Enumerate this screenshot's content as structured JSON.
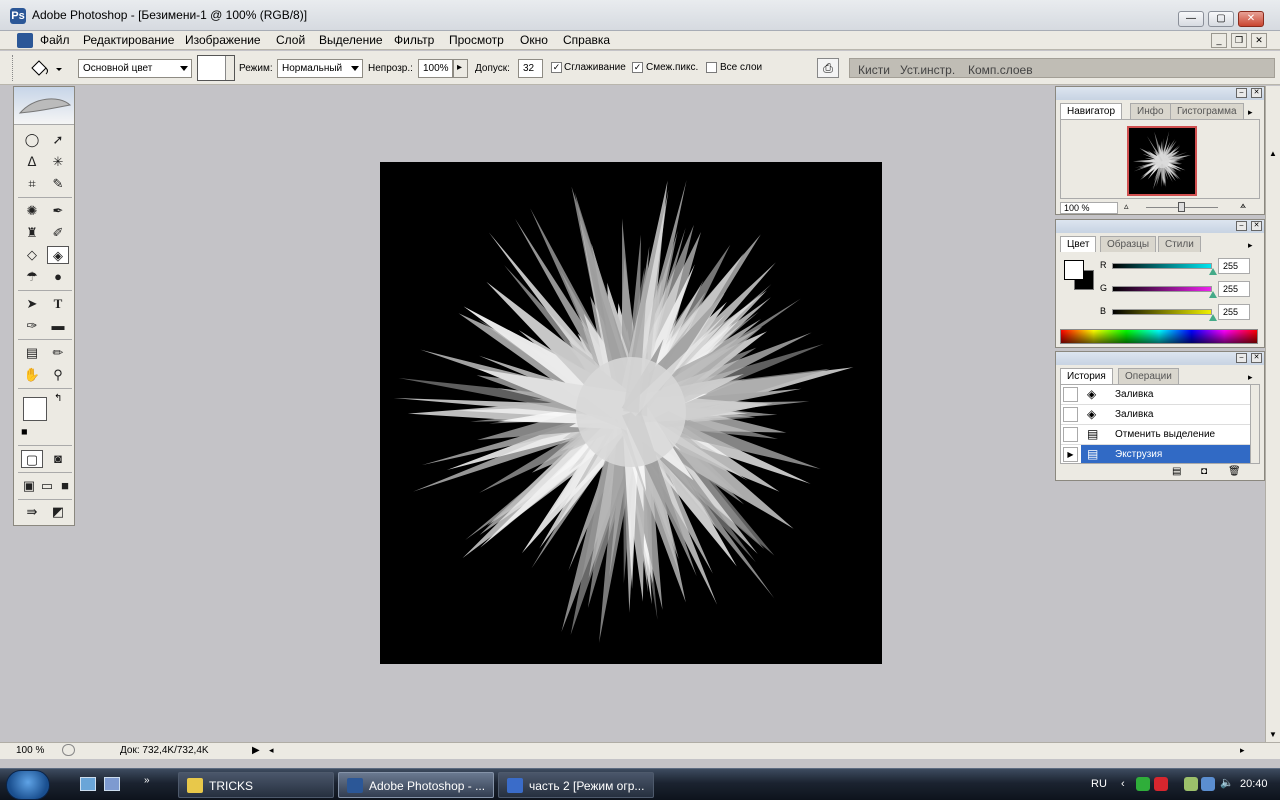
{
  "window": {
    "title": "Adobe Photoshop - [Безимени-1 @ 100% (RGB/8)]",
    "icon": "photoshop-feather-icon"
  },
  "menu": {
    "items": [
      "Файл",
      "Редактирование",
      "Изображение",
      "Слой",
      "Выделение",
      "Фильтр",
      "Просмотр",
      "Окно",
      "Справка"
    ]
  },
  "options": {
    "fill_source": "Основной цвет",
    "mode_label": "Режим:",
    "mode_value": "Нормальный",
    "opacity_label": "Непрозр.:",
    "opacity_value": "100%",
    "tolerance_label": "Допуск:",
    "tolerance_value": "32",
    "antialias_label": "Сглаживание",
    "antialias_checked": true,
    "contiguous_label": "Смеж.пикс.",
    "contiguous_checked": true,
    "all_layers_label": "Все слои",
    "all_layers_checked": false
  },
  "palette_well": {
    "tabs": [
      "Кисти",
      "Уст.инстр.",
      "Комп.слоев"
    ]
  },
  "navigator": {
    "tabs": [
      "Навигатор",
      "Инфо",
      "Гистограмма"
    ],
    "zoom": "100 %"
  },
  "color": {
    "tabs": [
      "Цвет",
      "Образцы",
      "Стили"
    ],
    "channels": [
      {
        "label": "R",
        "value": "255",
        "color": "#00e5f0"
      },
      {
        "label": "G",
        "value": "255",
        "color": "#ee22ee"
      },
      {
        "label": "B",
        "value": "255",
        "color": "#f0f000"
      }
    ]
  },
  "history": {
    "tabs": [
      "История",
      "Операции"
    ],
    "rows": [
      "Заливка",
      "Заливка",
      "Отменить выделение",
      "Экструзия"
    ],
    "active_index": 3
  },
  "status": {
    "zoom": "100 %",
    "doc": "Док: 732,4K/732,4K"
  },
  "taskbar": {
    "items": [
      "TRICKS",
      "Adobe Photoshop - ...",
      "часть 2 [Режим огр..."
    ],
    "language": "RU",
    "clock": "20:40"
  },
  "colors": {
    "history_highlight": "#316ac5",
    "canvas_background": "#000000",
    "workspace": "#c4c3c7"
  }
}
